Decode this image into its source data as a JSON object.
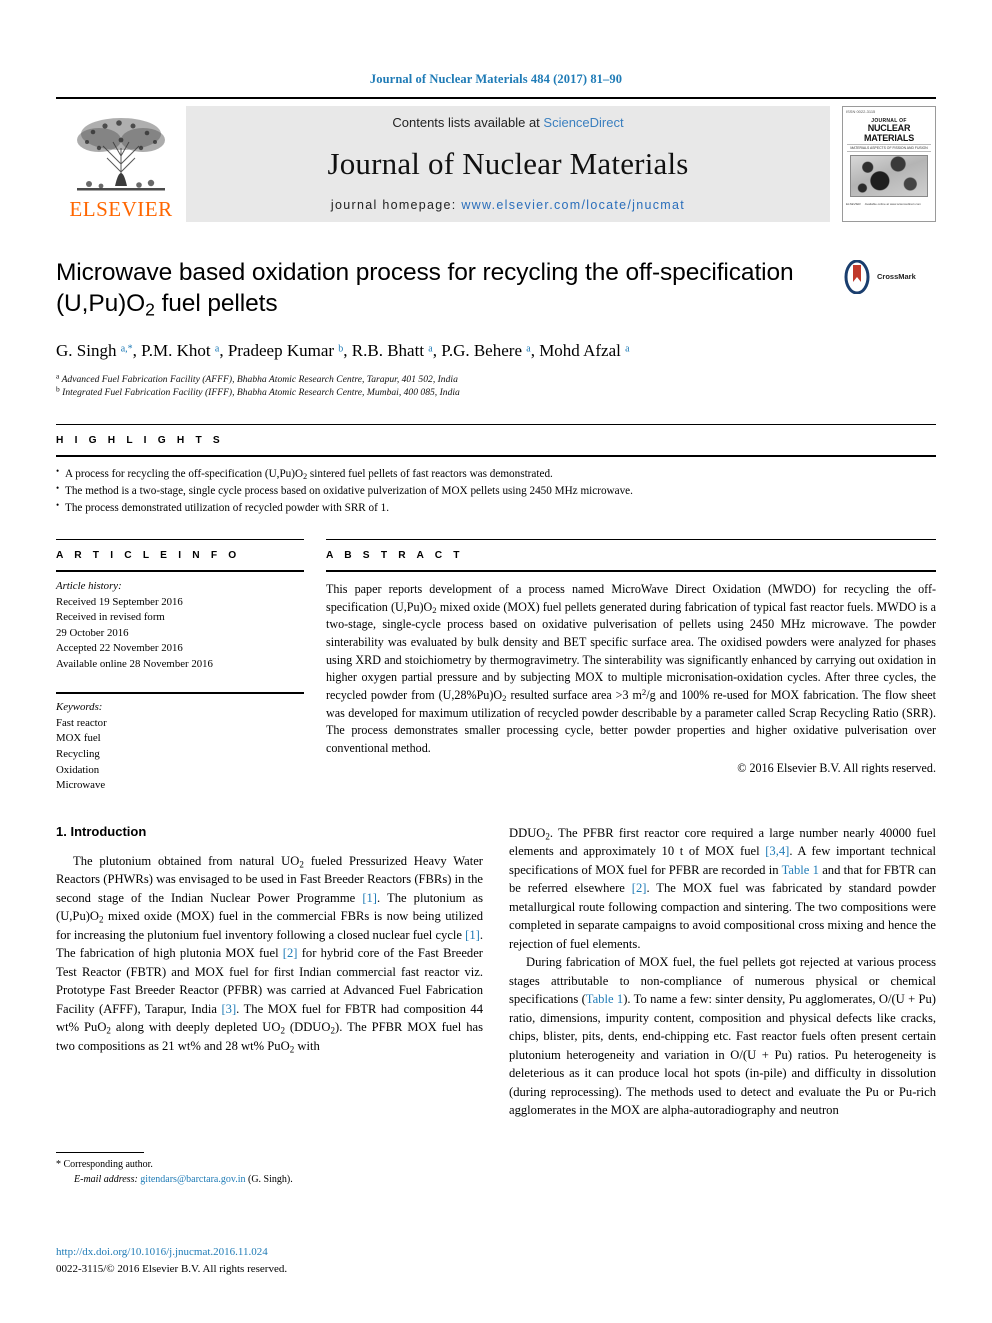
{
  "running_head": "Journal of Nuclear Materials 484 (2017) 81–90",
  "masthead": {
    "publisher": "ELSEVIER",
    "contents_prefix": "Contents lists available at ",
    "contents_link": "ScienceDirect",
    "journal_title": "Journal of Nuclear Materials",
    "homepage_prefix": "journal homepage: ",
    "homepage_url": "www.elsevier.com/locate/jnucmat",
    "cover": {
      "top_note": "ISSN 0022-3115",
      "band_line1": "JOURNAL OF",
      "band_line2": "NUCLEAR MATERIALS",
      "band_sub": "MATERIALS ASPECTS OF FISSION AND FUSION",
      "footer_left": "ELSEVIER",
      "footer_right": "Available online at www.sciencedirect.com"
    }
  },
  "title": "Microwave based oxidation process for recycling the off-specification (U,Pu)O2 fuel pellets",
  "crossmark_label": "CrossMark",
  "authors": "G. Singh a,*, P.M. Khot a, Pradeep Kumar b, R.B. Bhatt a, P.G. Behere a, Mohd Afzal a",
  "affiliations": [
    "a Advanced Fuel Fabrication Facility (AFFF), Bhabha Atomic Research Centre, Tarapur, 401 502, India",
    "b Integrated Fuel Fabrication Facility (IFFF), Bhabha Atomic Research Centre, Mumbai, 400 085, India"
  ],
  "highlights": {
    "heading": "H I G H L I G H T S",
    "items": [
      "A process for recycling the off-specification (U,Pu)O2 sintered fuel pellets of fast reactors was demonstrated.",
      "The method is a two-stage, single cycle process based on oxidative pulverization of MOX pellets using 2450 MHz microwave.",
      "The process demonstrated utilization of recycled powder with SRR of 1."
    ]
  },
  "article_info": {
    "heading": "A R T I C L E  I N F O",
    "history_label": "Article history:",
    "history": [
      "Received 19 September 2016",
      "Received in revised form",
      "29 October 2016",
      "Accepted 22 November 2016",
      "Available online 28 November 2016"
    ],
    "keywords_label": "Keywords:",
    "keywords": [
      "Fast reactor",
      "MOX fuel",
      "Recycling",
      "Oxidation",
      "Microwave"
    ]
  },
  "abstract": {
    "heading": "A B S T R A C T",
    "text": "This paper reports development of a process named MicroWave Direct Oxidation (MWDO) for recycling the off-specification (U,Pu)O2 mixed oxide (MOX) fuel pellets generated during fabrication of typical fast reactor fuels. MWDO is a two-stage, single-cycle process based on oxidative pulverisation of pellets using 2450 MHz microwave. The powder sinterability was evaluated by bulk density and BET specific surface area. The oxidised powders were analyzed for phases using XRD and stoichiometry by thermogravimetry. The sinterability was significantly enhanced by carrying out oxidation in higher oxygen partial pressure and by subjecting MOX to multiple micronisation-oxidation cycles. After three cycles, the recycled powder from (U,28%Pu)O2 resulted surface area >3 m2/g and 100% re-used for MOX fabrication. The flow sheet was developed for maximum utilization of recycled powder describable by a parameter called Scrap Recycling Ratio (SRR). The process demonstrates smaller processing cycle, better powder properties and higher oxidative pulverisation over conventional method.",
    "copyright": "© 2016 Elsevier B.V. All rights reserved."
  },
  "body": {
    "section_number_title": "1. Introduction",
    "left_paragraph": "The plutonium obtained from natural UO2 fueled Pressurized Heavy Water Reactors (PHWRs) was envisaged to be used in Fast Breeder Reactors (FBRs) in the second stage of the Indian Nuclear Power Programme [1]. The plutonium as (U,Pu)O2 mixed oxide (MOX) fuel in the commercial FBRs is now being utilized for increasing the plutonium fuel inventory following a closed nuclear fuel cycle [1]. The fabrication of high plutonia MOX fuel [2] for hybrid core of the Fast Breeder Test Reactor (FBTR) and MOX fuel for first Indian commercial fast reactor viz. Prototype Fast Breeder Reactor (PFBR) was carried at Advanced Fuel Fabrication Facility (AFFF), Tarapur, India [3]. The MOX fuel for FBTR had composition 44 wt% PuO2 along with deeply depleted UO2 (DDUO2). The PFBR MOX fuel has two compositions as 21 wt% and 28 wt% PuO2 with",
    "right_paragraph_1": "DDUO2. The PFBR first reactor core required a large number nearly 40000 fuel elements and approximately 10 t of MOX fuel [3,4]. A few important technical specifications of MOX fuel for PFBR are recorded in Table 1 and that for FBTR can be referred elsewhere [2]. The MOX fuel was fabricated by standard powder metallurgical route following compaction and sintering. The two compositions were completed in separate campaigns to avoid compositional cross mixing and hence the rejection of fuel elements.",
    "right_paragraph_2": "During fabrication of MOX fuel, the fuel pellets got rejected at various process stages attributable to non-compliance of numerous physical or chemical specifications (Table 1). To name a few: sinter density, Pu agglomerates, O/(U + Pu) ratio, dimensions, impurity content, composition and physical defects like cracks, chips, blister, pits, dents, end-chipping etc. Fast reactor fuels often present certain plutonium heterogeneity and variation in O/(U + Pu) ratios. Pu heterogeneity is deleterious as it can produce local hot spots (in-pile) and difficulty in dissolution (during reprocessing). The methods used to detect and evaluate the Pu or Pu-rich agglomerates in the MOX are alpha-autoradiography and neutron"
  },
  "footnote": {
    "corresponding": "* Corresponding author.",
    "email_label": "E-mail address:",
    "email": "gitendars@barctara.gov.in",
    "email_suffix": "(G. Singh)."
  },
  "footer": {
    "doi": "http://dx.doi.org/10.1016/j.jnucmat.2016.11.024",
    "issn": "0022-3115/© 2016 Elsevier B.V. All rights reserved."
  },
  "colors": {
    "link_blue": "#1f7bb6",
    "elsevier_orange": "#ff6600",
    "masthead_gray": "#e8e8e8"
  }
}
